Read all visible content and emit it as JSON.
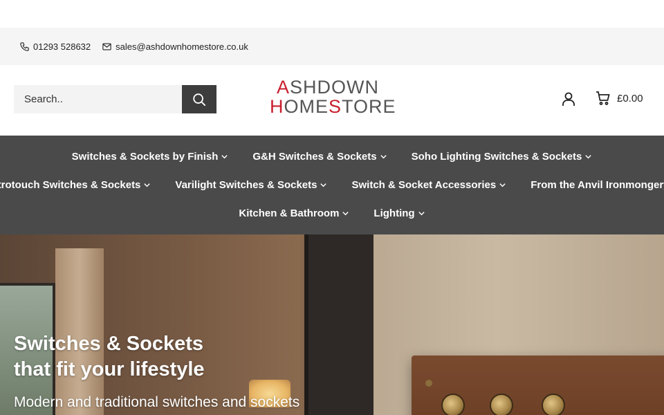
{
  "contact": {
    "phone": "01293 528632",
    "email": "sales@ashdownhomestore.co.uk"
  },
  "search": {
    "placeholder": "Search.."
  },
  "logo": {
    "line1_first": "A",
    "line1_rest": "SHDOWN",
    "line2_first": "H",
    "line2_mid": "OME",
    "line2_s": "S",
    "line2_rest": "TORE"
  },
  "cart": {
    "total": "£0.00"
  },
  "nav": {
    "row1": [
      "Switches & Sockets by Finish",
      "G&H Switches & Sockets",
      "Soho Lighting Switches & Sockets"
    ],
    "row2": [
      "Retrotouch Switches & Sockets",
      "Varilight Switches & Sockets",
      "Switch & Socket Accessories",
      "From the Anvil Ironmongery"
    ],
    "row3": [
      "Kitchen & Bathroom",
      "Lighting"
    ]
  },
  "hero": {
    "heading_line1": "Switches & Sockets",
    "heading_line2": "that fit your lifestyle",
    "subheading": "Modern and traditional switches and sockets"
  },
  "colors": {
    "nav_bg": "#4a4a4a",
    "brand_red": "#c8202f",
    "search_button": "#3d3d3d"
  }
}
